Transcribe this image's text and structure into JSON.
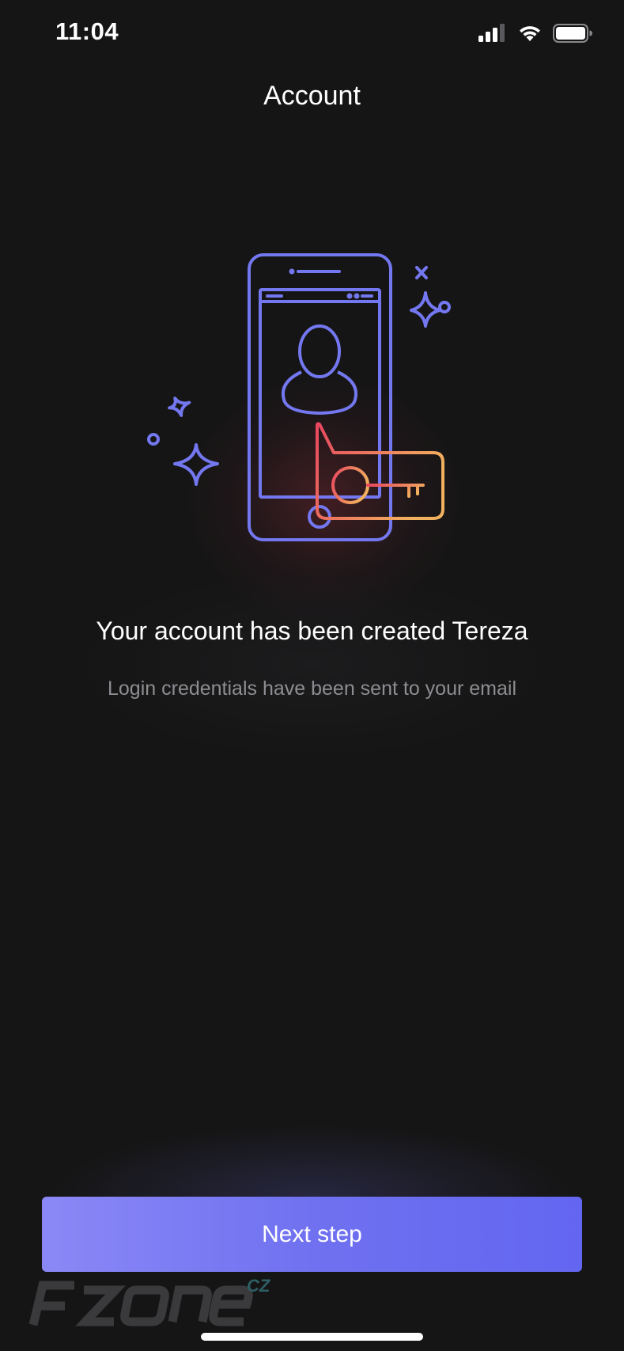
{
  "status_bar": {
    "time": "11:04"
  },
  "header": {
    "title": "Account"
  },
  "illustration": {
    "description_icons": [
      "phone-icon",
      "user-icon",
      "key-icon",
      "sparkle-icon"
    ],
    "colors": {
      "outline": "#7478f0",
      "key_gradient_start": "#e8475f",
      "key_gradient_end": "#f2b15f"
    }
  },
  "message": {
    "headline": "Your account has been created Tereza",
    "subline": "Login credentials have been sent to your email"
  },
  "actions": {
    "next_label": "Next step"
  },
  "watermark": {
    "brand": "FZONE",
    "suffix": "CZ"
  },
  "colors": {
    "background": "#151515",
    "accent": "#6366f1",
    "accent_light": "#8b88f6",
    "muted_text": "#8d8d92"
  }
}
